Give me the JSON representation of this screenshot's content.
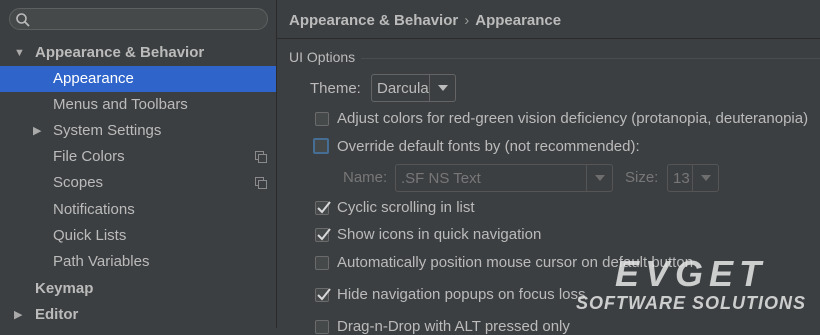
{
  "sidebar": {
    "search_placeholder": "",
    "items": [
      {
        "label": "Appearance & Behavior",
        "arrow": "▼"
      },
      {
        "label": "Appearance"
      },
      {
        "label": "Menus and Toolbars"
      },
      {
        "label": "System Settings",
        "arrow": "▶"
      },
      {
        "label": "File Colors"
      },
      {
        "label": "Scopes"
      },
      {
        "label": "Notifications"
      },
      {
        "label": "Quick Lists"
      },
      {
        "label": "Path Variables"
      },
      {
        "label": "Keymap"
      },
      {
        "label": "Editor",
        "arrow": "▶"
      }
    ]
  },
  "breadcrumb": {
    "parent": "Appearance & Behavior",
    "separator": "›",
    "current": "Appearance"
  },
  "ui_options": {
    "title": "UI Options",
    "theme_label": "Theme:",
    "theme_value": "Darcula",
    "adjust_colors": {
      "label": "Adjust colors for red-green vision deficiency (protanopia, deuteranopia)",
      "checked": false
    },
    "override_fonts": {
      "label": "Override default fonts by (not recommended):",
      "checked": false
    },
    "name_label": "Name:",
    "name_value": ".SF NS Text",
    "size_label": "Size:",
    "size_value": "13",
    "options": [
      {
        "label": "Cyclic scrolling in list",
        "checked": true
      },
      {
        "label": "Show icons in quick navigation",
        "checked": true
      },
      {
        "label": "Automatically position mouse cursor on default button",
        "checked": false
      },
      {
        "label": "Hide navigation popups on focus loss",
        "checked": true
      },
      {
        "label": "Drag-n-Drop with ALT pressed only",
        "checked": false
      }
    ]
  },
  "watermark": {
    "line1": "EVGET",
    "line2": "SOFTWARE SOLUTIONS"
  },
  "colors": {
    "selection": "#2f65ca",
    "background": "#3c3f41",
    "text": "#bbbbbb"
  }
}
